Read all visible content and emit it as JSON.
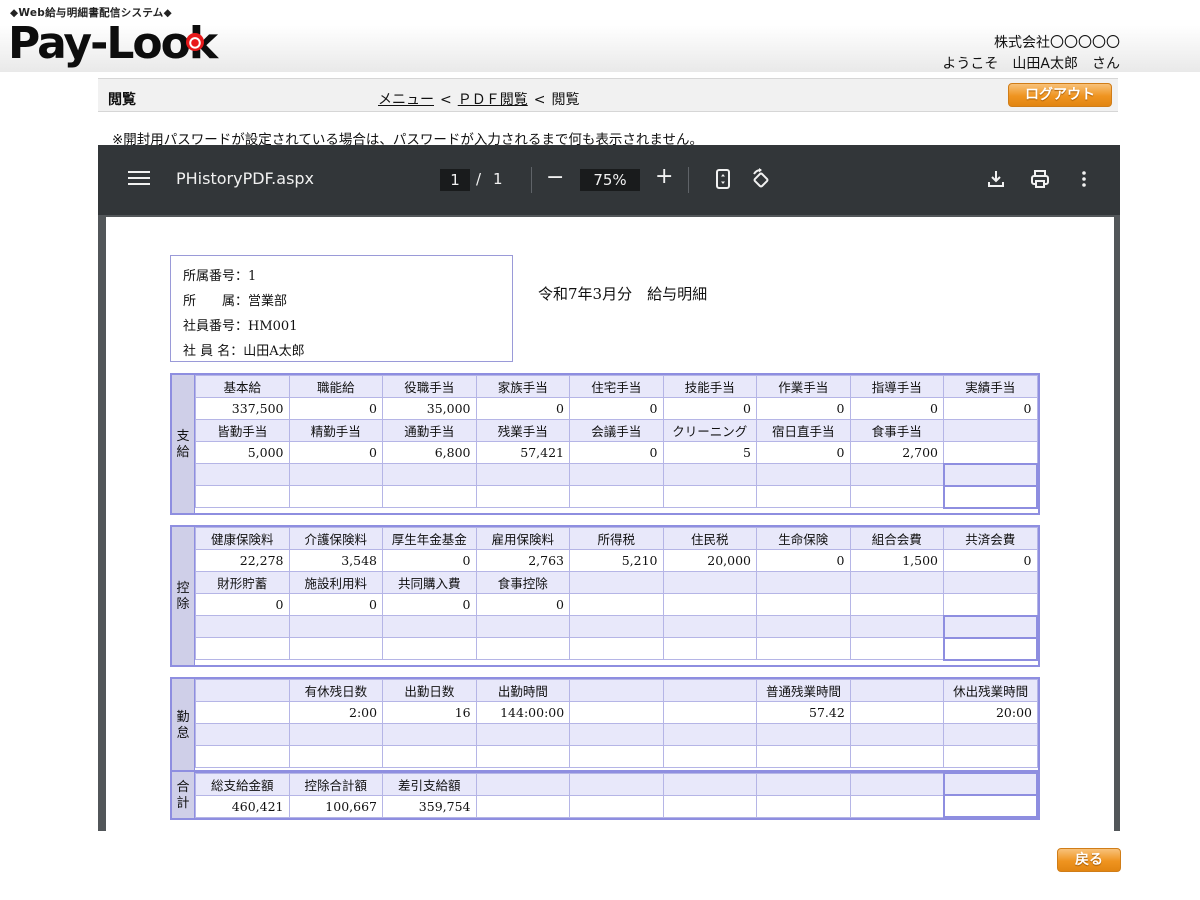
{
  "header": {
    "tagline": "◆Web給与明細書配信システム◆",
    "logo": "Pay-Look",
    "company": "株式会社〇〇〇〇〇",
    "welcome": "ようこそ　山田A太郎　さん"
  },
  "nav": {
    "section_title": "閲覧",
    "breadcrumb_menu": "メニュー",
    "breadcrumb_pdf": "ＰＤＦ閲覧",
    "breadcrumb_current": "閲覧",
    "separator": "<",
    "logout_label": "ログアウト"
  },
  "notice": "※開封用パスワードが設定されている場合は、パスワードが入力されるまで何も表示されません。",
  "viewer": {
    "filename": "PHistoryPDF.aspx",
    "page_current": "1",
    "page_separator": "/",
    "page_total": "1",
    "zoom": "75%",
    "minus": "−",
    "plus": "+",
    "icons": [
      "menu-icon",
      "fit-page-icon",
      "rotate-icon",
      "download-icon",
      "print-icon",
      "more-vert-icon"
    ]
  },
  "payslip": {
    "info": {
      "dept_no": "所属番号：1",
      "dept": "所　　属：営業部",
      "emp_no": "社員番号：HM001",
      "name": "社 員 名：山田A太郎"
    },
    "title": "令和7年3月分　給与明細",
    "sections": [
      {
        "id": "pay",
        "label": [
          "支",
          "給"
        ],
        "rows": [
          {
            "type": "h",
            "cells": [
              "基本給",
              "職能給",
              "役職手当",
              "家族手当",
              "住宅手当",
              "技能手当",
              "作業手当",
              "指導手当",
              "実績手当"
            ]
          },
          {
            "type": "v",
            "cells": [
              "337,500",
              "0",
              "35,000",
              "0",
              "0",
              "0",
              "0",
              "0",
              "0"
            ]
          },
          {
            "type": "h",
            "cells": [
              "皆勤手当",
              "精勤手当",
              "通勤手当",
              "残業手当",
              "会議手当",
              "クリーニング",
              "宿日直手当",
              "食事手当",
              ""
            ]
          },
          {
            "type": "v",
            "cells": [
              "5,000",
              "0",
              "6,800",
              "57,421",
              "0",
              "5",
              "0",
              "2,700",
              ""
            ]
          },
          {
            "type": "h",
            "cells": [
              "",
              "",
              "",
              "",
              "",
              "",
              "",
              "",
              ""
            ]
          },
          {
            "type": "v",
            "cells": [
              "",
              "",
              "",
              "",
              "",
              "",
              "",
              "",
              ""
            ]
          }
        ]
      },
      {
        "id": "deduct",
        "label": [
          "控",
          "除"
        ],
        "rows": [
          {
            "type": "h",
            "cells": [
              "健康保険料",
              "介護保険料",
              "厚生年金基金",
              "雇用保険料",
              "所得税",
              "住民税",
              "生命保険",
              "組合会費",
              "共済会費"
            ]
          },
          {
            "type": "v",
            "cells": [
              "22,278",
              "3,548",
              "0",
              "2,763",
              "5,210",
              "20,000",
              "0",
              "1,500",
              "0"
            ]
          },
          {
            "type": "h",
            "cells": [
              "財形貯蓄",
              "施設利用料",
              "共同購入費",
              "食事控除",
              "",
              "",
              "",
              "",
              ""
            ]
          },
          {
            "type": "v",
            "cells": [
              "0",
              "0",
              "0",
              "0",
              "",
              "",
              "",
              "",
              ""
            ]
          },
          {
            "type": "h",
            "cells": [
              "",
              "",
              "",
              "",
              "",
              "",
              "",
              "",
              ""
            ]
          },
          {
            "type": "v",
            "cells": [
              "",
              "",
              "",
              "",
              "",
              "",
              "",
              "",
              ""
            ]
          }
        ]
      },
      {
        "id": "attend",
        "label": [
          "勤",
          "怠"
        ],
        "rows": [
          {
            "type": "h",
            "cells": [
              "",
              "有休残日数",
              "出勤日数",
              "出勤時間",
              "",
              "",
              "普通残業時間",
              "",
              "休出残業時間"
            ]
          },
          {
            "type": "v",
            "cells": [
              "",
              "2:00",
              "16",
              "144:00:00",
              "",
              "",
              "57.42",
              "",
              "20:00"
            ]
          },
          {
            "type": "h",
            "cells": [
              "",
              "",
              "",
              "",
              "",
              "",
              "",
              "",
              ""
            ]
          },
          {
            "type": "v",
            "cells": [
              "",
              "",
              "",
              "",
              "",
              "",
              "",
              "",
              ""
            ]
          }
        ]
      },
      {
        "id": "total",
        "label": [
          "合",
          "計"
        ],
        "rows": [
          {
            "type": "h",
            "cells": [
              "総支給金額",
              "控除合計額",
              "差引支給額",
              "",
              "",
              "",
              "",
              "",
              ""
            ]
          },
          {
            "type": "v",
            "cells": [
              "460,421",
              "100,667",
              "359,754",
              "",
              "",
              "",
              "",
              "",
              ""
            ]
          }
        ]
      }
    ]
  },
  "footer": {
    "back_label": "戻る"
  }
}
